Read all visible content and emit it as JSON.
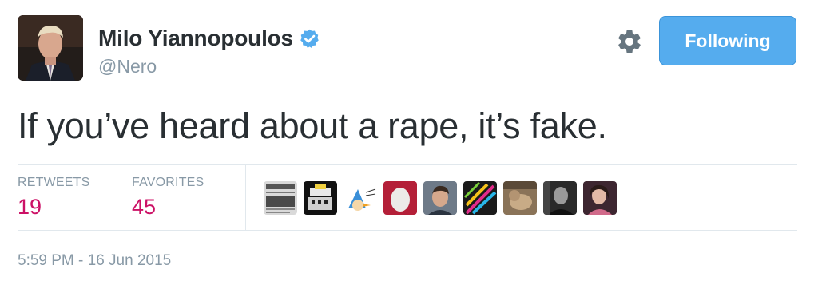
{
  "author": {
    "display_name": "Milo Yiannopoulos",
    "handle": "@Nero",
    "verified": true,
    "avatar_icon": "profile-photo"
  },
  "actions": {
    "follow_label": "Following",
    "settings_icon": "gear-icon"
  },
  "tweet": {
    "text": "If you’ve heard about a rape, it’s fake."
  },
  "stats": {
    "retweets_label": "RETWEETS",
    "retweets_count": "19",
    "favorites_label": "FAVORITES",
    "favorites_count": "45"
  },
  "favoriters": [
    {
      "icon": "newspaper-avatar"
    },
    {
      "icon": "pixel-art-avatar"
    },
    {
      "icon": "cartoon-bird-avatar"
    },
    {
      "icon": "egg-avatar"
    },
    {
      "icon": "man-photo-avatar"
    },
    {
      "icon": "colorful-lines-avatar"
    },
    {
      "icon": "animal-photo-avatar"
    },
    {
      "icon": "bw-photo-avatar"
    },
    {
      "icon": "woman-photo-avatar"
    }
  ],
  "timestamp": "5:59 PM - 16 Jun 2015",
  "colors": {
    "accent": "#55acee",
    "stat_value": "#cc1166",
    "muted": "#8899a6",
    "text": "#292f33"
  }
}
